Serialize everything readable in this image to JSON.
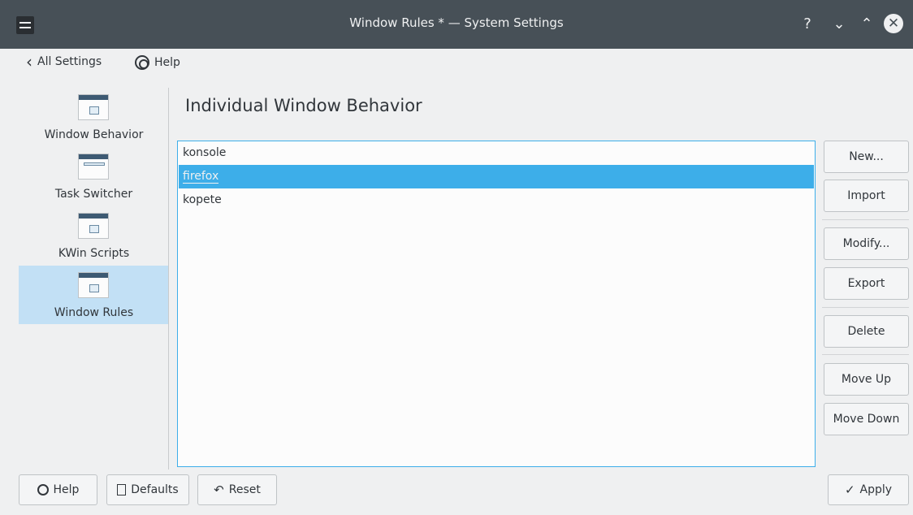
{
  "window": {
    "title": "Window Rules * — System Settings",
    "help_glyph": "?",
    "minimize_glyph": "⌄",
    "maximize_glyph": "⌃",
    "close_glyph": "✕"
  },
  "toolbar": {
    "all_settings_label": "All Settings",
    "help_label": "Help"
  },
  "sidebar": {
    "items": [
      {
        "label": "Window Behavior"
      },
      {
        "label": "Task Switcher"
      },
      {
        "label": "KWin Scripts"
      },
      {
        "label": "Window Rules"
      }
    ]
  },
  "main": {
    "heading": "Individual Window Behavior",
    "rules": [
      "konsole",
      "firefox",
      "kopete"
    ],
    "buttons": {
      "new": "New...",
      "import": "Import",
      "modify": "Modify...",
      "export": "Export",
      "delete": "Delete",
      "move_up": "Move Up",
      "move_down": "Move Down"
    }
  },
  "footer": {
    "help": "Help",
    "defaults": "Defaults",
    "reset": "Reset",
    "apply": "Apply",
    "apply_check": "✓",
    "reset_glyph": "↶"
  },
  "colors": {
    "titlebar": "#475057",
    "accent": "#3daee9",
    "sidebar_selected": "#c2e0f5",
    "background": "#eff0f1"
  },
  "icons": [
    "settings-app-icon",
    "back-chevron-icon",
    "help-lifebuoy-icon",
    "window-icon",
    "defaults-icon",
    "reset-icon",
    "checkmark-icon"
  ]
}
